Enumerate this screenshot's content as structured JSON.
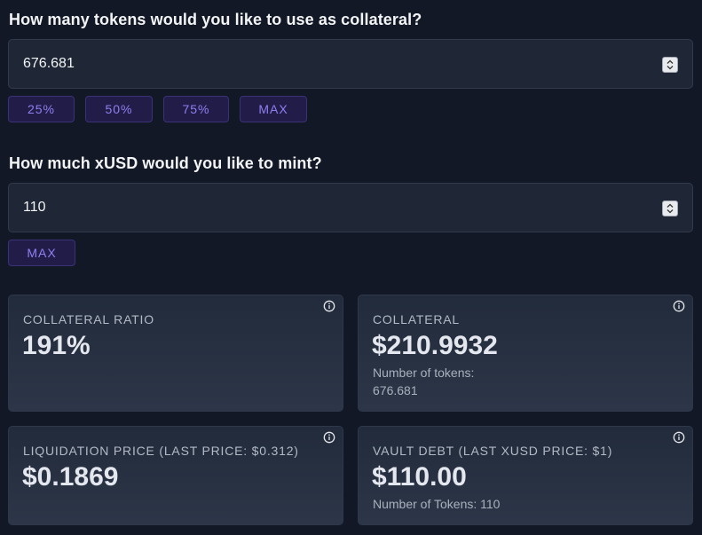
{
  "collateral_input": {
    "question": "How many tokens would you like to use as collateral?",
    "value": "676.681",
    "quick_buttons": [
      "25%",
      "50%",
      "75%",
      "MAX"
    ]
  },
  "mint_input": {
    "question": "How much xUSD would you like to mint?",
    "value": "110",
    "max_label": "MAX"
  },
  "stats": {
    "collateral_ratio": {
      "label": "COLLATERAL RATIO",
      "value": "191%"
    },
    "collateral": {
      "label": "COLLATERAL",
      "value": "$210.9932",
      "tokens_label": "Number of tokens:",
      "tokens_value": "676.681"
    },
    "liquidation_price": {
      "label": "LIQUIDATION PRICE (LAST PRICE: $0.312)",
      "value": "$0.1869"
    },
    "vault_debt": {
      "label": "VAULT DEBT (LAST XUSD PRICE: $1)",
      "value": "$110.00",
      "tokens_text": "Number of Tokens: 110"
    }
  },
  "colors": {
    "background": "#121826",
    "accent": "#8f7ff2",
    "pill_bg": "#221d48",
    "card_bg": "#262f40"
  }
}
